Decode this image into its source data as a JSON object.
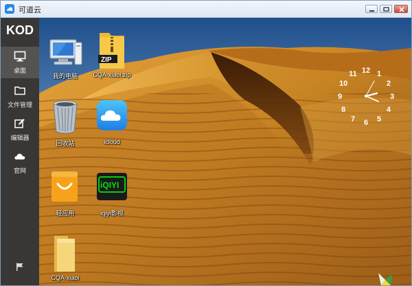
{
  "window": {
    "title": "可道云"
  },
  "sidebar": {
    "logo": "KOD",
    "items": [
      {
        "label": "桌面",
        "icon": "monitor-icon",
        "active": true
      },
      {
        "label": "文件管理",
        "icon": "folder-icon",
        "active": false
      },
      {
        "label": "编辑器",
        "icon": "edit-icon",
        "active": false
      },
      {
        "label": "官网",
        "icon": "cloud-icon",
        "active": false
      }
    ],
    "bottom_icon": "flag-icon"
  },
  "desktop": {
    "icons": [
      {
        "label": "我的电脑",
        "icon": "computer-icon"
      },
      {
        "label": "CQA-xiaoi.zip",
        "icon": "zip-folder-icon"
      },
      {
        "label": "回收站",
        "icon": "recycle-bin-icon"
      },
      {
        "label": "icloud",
        "icon": "icloud-icon"
      },
      {
        "label": "轻应用",
        "icon": "shopping-bag-icon"
      },
      {
        "label": "iqiyi影视",
        "icon": "iqiyi-icon"
      },
      {
        "label": "CQA-xiaoi",
        "icon": "folder-icon"
      }
    ],
    "zip_badge": "ZIP",
    "iqiyi_badge": "iQIYI",
    "clock": {
      "numbers": [
        "12",
        "1",
        "2",
        "3",
        "4",
        "5",
        "6",
        "7",
        "8",
        "9",
        "10",
        "11"
      ]
    }
  },
  "colors": {
    "sidebar_bg": "#221e1a",
    "accent": "#2b86e6",
    "sand": "#c9871f",
    "sky": "#3a6da8"
  }
}
